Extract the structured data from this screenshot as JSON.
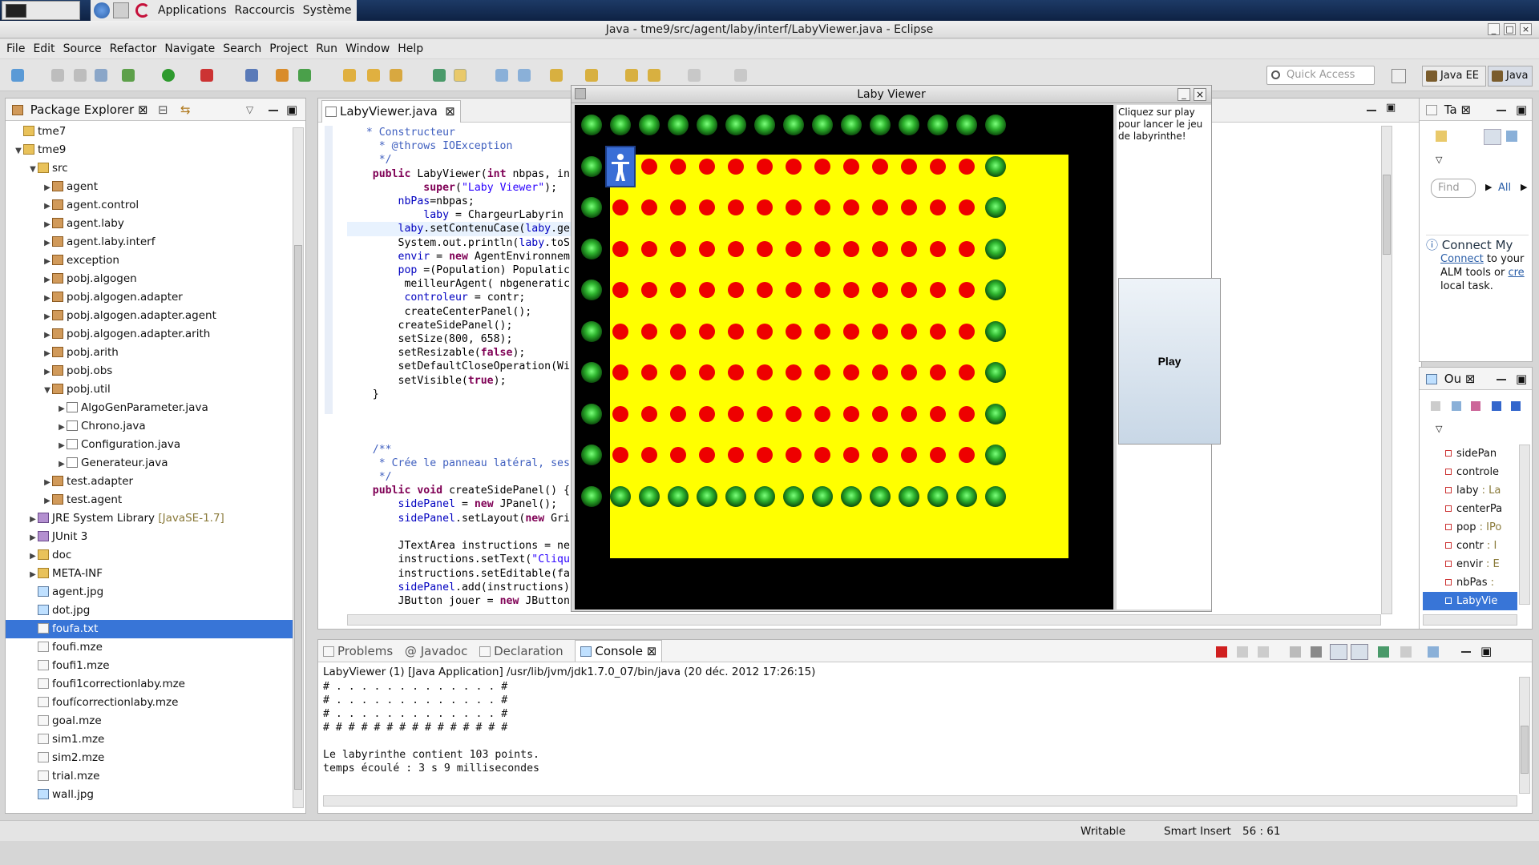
{
  "desktop": {
    "menu_applications": "Applications",
    "menu_shortcuts": "Raccourcis",
    "menu_system": "Système"
  },
  "window": {
    "title": "Java - tme9/src/agent/laby/interf/LabyViewer.java - Eclipse"
  },
  "menubar": [
    "File",
    "Edit",
    "Source",
    "Refactor",
    "Navigate",
    "Search",
    "Project",
    "Run",
    "Window",
    "Help"
  ],
  "toolbar": {
    "quick_access_placeholder": "Quick Access",
    "perspective_javaee": "Java EE",
    "perspective_java": "Java"
  },
  "package_explorer": {
    "title": "Package Explorer",
    "items": [
      {
        "label": "tme7",
        "indent": 0,
        "twisty": "",
        "icon": "project"
      },
      {
        "label": "tme9",
        "indent": 0,
        "twisty": "open",
        "icon": "project"
      },
      {
        "label": "src",
        "indent": 1,
        "twisty": "open",
        "icon": "folder"
      },
      {
        "label": "agent",
        "indent": 2,
        "twisty": "closed",
        "icon": "package"
      },
      {
        "label": "agent.control",
        "indent": 2,
        "twisty": "closed",
        "icon": "package"
      },
      {
        "label": "agent.laby",
        "indent": 2,
        "twisty": "closed",
        "icon": "package"
      },
      {
        "label": "agent.laby.interf",
        "indent": 2,
        "twisty": "closed",
        "icon": "package"
      },
      {
        "label": "exception",
        "indent": 2,
        "twisty": "closed",
        "icon": "package"
      },
      {
        "label": "pobj.algogen",
        "indent": 2,
        "twisty": "closed",
        "icon": "package"
      },
      {
        "label": "pobj.algogen.adapter",
        "indent": 2,
        "twisty": "closed",
        "icon": "package"
      },
      {
        "label": "pobj.algogen.adapter.agent",
        "indent": 2,
        "twisty": "closed",
        "icon": "package"
      },
      {
        "label": "pobj.algogen.adapter.arith",
        "indent": 2,
        "twisty": "closed",
        "icon": "package"
      },
      {
        "label": "pobj.arith",
        "indent": 2,
        "twisty": "closed",
        "icon": "package"
      },
      {
        "label": "pobj.obs",
        "indent": 2,
        "twisty": "closed",
        "icon": "package"
      },
      {
        "label": "pobj.util",
        "indent": 2,
        "twisty": "open",
        "icon": "package"
      },
      {
        "label": "AlgoGenParameter.java",
        "indent": 3,
        "twisty": "closed",
        "icon": "java"
      },
      {
        "label": "Chrono.java",
        "indent": 3,
        "twisty": "closed",
        "icon": "java"
      },
      {
        "label": "Configuration.java",
        "indent": 3,
        "twisty": "closed",
        "icon": "java"
      },
      {
        "label": "Generateur.java",
        "indent": 3,
        "twisty": "closed",
        "icon": "java"
      },
      {
        "label": "test.adapter",
        "indent": 2,
        "twisty": "closed",
        "icon": "package"
      },
      {
        "label": "test.agent",
        "indent": 2,
        "twisty": "closed",
        "icon": "package"
      },
      {
        "label": "JRE System Library",
        "suffix": "[JavaSE-1.7]",
        "indent": 1,
        "twisty": "closed",
        "icon": "library"
      },
      {
        "label": "JUnit 3",
        "indent": 1,
        "twisty": "closed",
        "icon": "library"
      },
      {
        "label": "doc",
        "indent": 1,
        "twisty": "closed",
        "icon": "folder"
      },
      {
        "label": "META-INF",
        "indent": 1,
        "twisty": "closed",
        "icon": "folder"
      },
      {
        "label": "agent.jpg",
        "indent": 1,
        "twisty": "",
        "icon": "image"
      },
      {
        "label": "dot.jpg",
        "indent": 1,
        "twisty": "",
        "icon": "image"
      },
      {
        "label": "foufa.txt",
        "indent": 1,
        "twisty": "",
        "icon": "text",
        "selected": true
      },
      {
        "label": "foufi.mze",
        "indent": 1,
        "twisty": "",
        "icon": "text"
      },
      {
        "label": "foufi1.mze",
        "indent": 1,
        "twisty": "",
        "icon": "text"
      },
      {
        "label": "foufi1correctionlaby.mze",
        "indent": 1,
        "twisty": "",
        "icon": "text"
      },
      {
        "label": "foufícorrectionlaby.mze",
        "indent": 1,
        "twisty": "",
        "icon": "text"
      },
      {
        "label": "goal.mze",
        "indent": 1,
        "twisty": "",
        "icon": "text"
      },
      {
        "label": "sim1.mze",
        "indent": 1,
        "twisty": "",
        "icon": "text"
      },
      {
        "label": "sim2.mze",
        "indent": 1,
        "twisty": "",
        "icon": "text"
      },
      {
        "label": "trial.mze",
        "indent": 1,
        "twisty": "",
        "icon": "text"
      },
      {
        "label": "wall.jpg",
        "indent": 1,
        "twisty": "",
        "icon": "image"
      }
    ]
  },
  "editor": {
    "tab": "LabyViewer.java",
    "lines": [
      "   * Constructeur",
      "     * @throws IOException",
      "     */",
      "    public LabyViewer(int nbpas, in",
      "            super(\"Laby Viewer\");",
      "        nbPas=nbpas;",
      "            laby = ChargeurLabyrin",
      "        laby.setContenuCase(laby.ge",
      "        System.out.println(laby.toS",
      "        envir = new AgentEnvironnem",
      "        pop =(Population) Populatic",
      "         meilleurAgent( nbgeneratic",
      "         controleur = contr;",
      "         createCenterPanel();",
      "        createSidePanel();",
      "        setSize(800, 658);",
      "        setResizable(false);",
      "        setDefaultCloseOperation(Wi",
      "        setVisible(true);",
      "    }",
      "",
      "",
      "",
      "    /**",
      "     * Crée le panneau latéral, ses",
      "     */",
      "    public void createSidePanel() {",
      "        sidePanel = new JPanel();",
      "        sidePanel.setLayout(new Gri",
      "",
      "        JTextArea instructions = ne",
      "        instructions.setText(\"Cliqu",
      "        instructions.setEditable(fa",
      "        sidePanel.add(instructions)",
      "        JButton jouer = new JButton"
    ]
  },
  "laby_viewer": {
    "title": "Laby Viewer",
    "instructions": "Cliquez sur play pour lancer le jeu de labyrinthe!",
    "play_label": "Play",
    "rows": 10,
    "cols": 15,
    "interior_rows": 8,
    "interior_cols": 13,
    "agent_row": 1,
    "agent_col": 1
  },
  "task_list": {
    "title": "Ta",
    "find_placeholder": "Find",
    "all_label": "All",
    "connect_title": "Connect My",
    "connect_link": "Connect",
    "connect_text": "to your ALM tools or",
    "connect_create": "cre",
    "connect_tail": "local task."
  },
  "outline": {
    "title": "Ou",
    "items": [
      {
        "name": "sidePan",
        "type": ""
      },
      {
        "name": "controle",
        "type": ""
      },
      {
        "name": "laby",
        "type": ": La"
      },
      {
        "name": "centerPa",
        "type": ""
      },
      {
        "name": "pop",
        "type": ": IPo"
      },
      {
        "name": "contr",
        "type": ": I"
      },
      {
        "name": "envir",
        "type": ": E"
      },
      {
        "name": "nbPas",
        "type": ":"
      },
      {
        "name": "LabyVie",
        "type": "",
        "selected": true
      }
    ]
  },
  "console": {
    "tabs": [
      "Problems",
      "Javadoc",
      "Declaration",
      "Console"
    ],
    "header": "LabyViewer (1) [Java Application] /usr/lib/jvm/jdk1.7.0_07/bin/java (20 déc. 2012 17:26:15)",
    "lines": [
      "# . . . . . . . . . . . . . #",
      "# . . . . . . . . . . . . . #",
      "# . . . . . . . . . . . . . #",
      "# # # # # # # # # # # # # # #",
      "",
      "Le labyrinthe contient 103 points.",
      "temps écoulé : 3 s 9 millisecondes"
    ]
  },
  "status": {
    "writable": "Writable",
    "insert_mode": "Smart Insert",
    "position": "56 : 61"
  },
  "colors": {
    "selection": "#3875d7",
    "maze_floor": "#ffff00",
    "dot": "#ee0000",
    "wall": "#2fb52f"
  }
}
